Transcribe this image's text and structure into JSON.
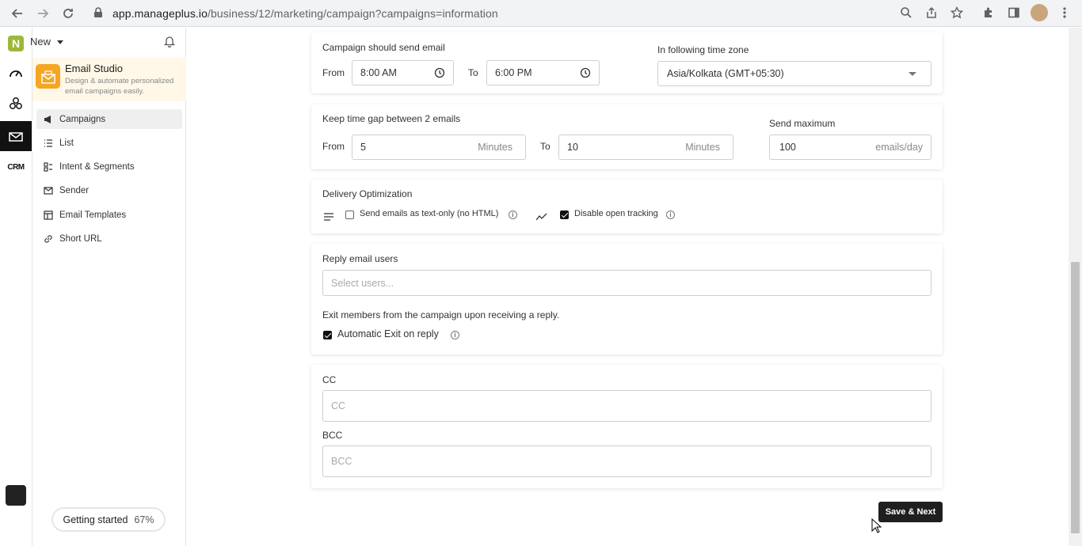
{
  "browser": {
    "url_host": "app.manageplus.io",
    "url_path": "/business/12/marketing/campaign?campaigns=information"
  },
  "rail": {
    "logo_letter": "N",
    "items": [
      "dashboard-icon",
      "segments-icon",
      "email-studio-icon",
      "crm-icon"
    ],
    "crm_label": "CRM"
  },
  "module": {
    "new_label": "New",
    "studio_title": "Email Studio",
    "studio_desc": "Design & automate personalized email campaigns easily.",
    "nav": [
      {
        "label": "Campaigns",
        "icon": "megaphone-icon",
        "active": true
      },
      {
        "label": "List",
        "icon": "list-icon",
        "active": false
      },
      {
        "label": "Intent & Segments",
        "icon": "segments-icon",
        "active": false
      },
      {
        "label": "Sender",
        "icon": "sender-icon",
        "active": false
      },
      {
        "label": "Email Templates",
        "icon": "templates-icon",
        "active": false
      },
      {
        "label": "Short URL",
        "icon": "link-icon",
        "active": false
      }
    ],
    "getting_started_label": "Getting started",
    "getting_started_pct": "67%"
  },
  "schedule": {
    "title": "Campaign should send email",
    "from_label": "From",
    "from_value": "8:00 AM",
    "to_label": "To",
    "to_value": "6:00 PM",
    "timezone_label": "In following time zone",
    "timezone_value": "Asia/Kolkata (GMT+05:30)"
  },
  "gap": {
    "title": "Keep time gap between 2 emails",
    "from_label": "From",
    "from_value": "5",
    "from_unit": "Minutes",
    "to_label": "To",
    "to_value": "10",
    "to_unit": "Minutes",
    "max_label": "Send maximum",
    "max_value": "100",
    "max_unit": "emails/day"
  },
  "delivery": {
    "title": "Delivery Optimization",
    "text_only_label": "Send emails as text-only (no HTML)",
    "text_only_checked": false,
    "open_tracking_label": "Disable open tracking",
    "open_tracking_checked": true
  },
  "reply": {
    "title": "Reply email users",
    "placeholder": "Select users...",
    "exit_desc": "Exit members from the campaign upon receiving a reply.",
    "auto_exit_label": "Automatic Exit on reply",
    "auto_exit_checked": true
  },
  "cc": {
    "cc_label": "CC",
    "cc_placeholder": "CC",
    "bcc_label": "BCC",
    "bcc_placeholder": "BCC"
  },
  "actions": {
    "save_next_label": "Save & Next"
  }
}
